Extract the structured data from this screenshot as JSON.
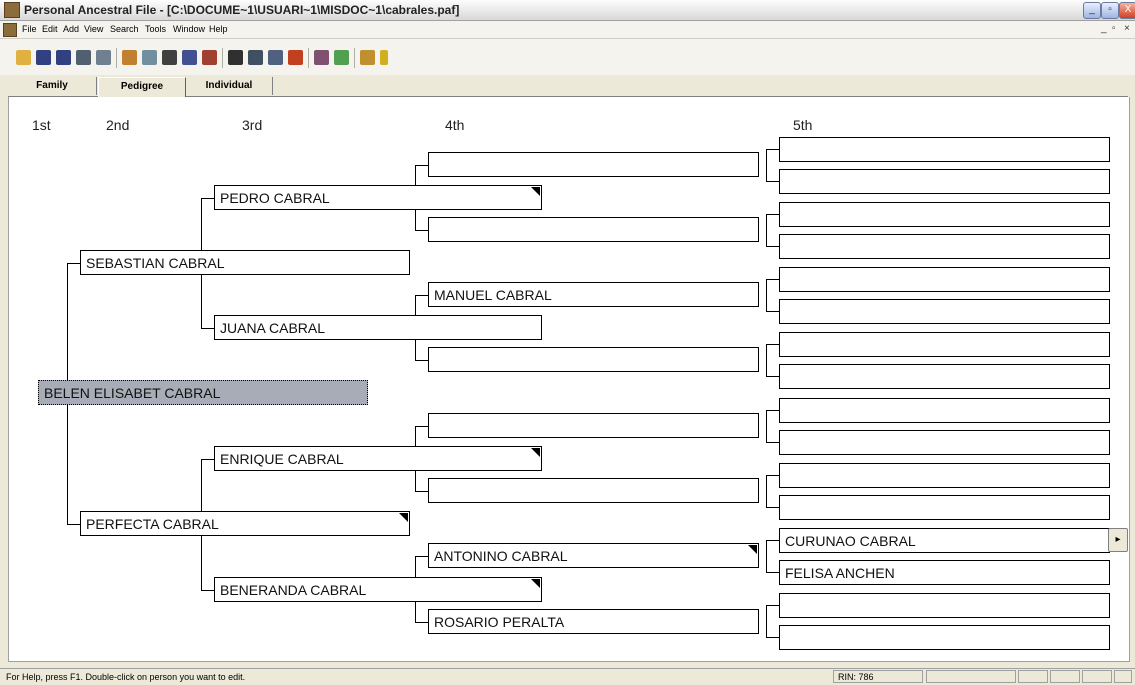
{
  "window": {
    "title": "Personal Ancestral File - [C:\\DOCUME~1\\USUARI~1\\MISDOC~1\\cabrales.paf]",
    "controls": [
      "_",
      "▫",
      "X"
    ]
  },
  "menu": {
    "items": [
      "File",
      "Edit",
      "Add",
      "View",
      "Search",
      "Tools",
      "Window",
      "Help"
    ],
    "mdi_controls": [
      "_",
      "▫",
      "×"
    ]
  },
  "toolbar": {
    "icons": [
      "open-folder-icon",
      "save-icon",
      "save-as-icon",
      "print-preview-icon",
      "print-icon",
      "spell-icon",
      "edit-icon",
      "camera-icon",
      "find-person-icon",
      "find-family-icon",
      "binoculars-icon",
      "search-icon",
      "relationship-icon",
      "tree-icon",
      "reports-icon",
      "photo-icon",
      "scale-icon",
      "help-icon"
    ]
  },
  "tabs": [
    "Family",
    "Pedigree",
    "Individual"
  ],
  "active_tab": "Pedigree",
  "generations": [
    "1st",
    "2nd",
    "3rd",
    "4th",
    "5th"
  ],
  "pedigree": {
    "gen1": "BELEN ELISABET CABRAL",
    "gen2": [
      "SEBASTIAN CABRAL",
      "PERFECTA CABRAL"
    ],
    "gen3": [
      "PEDRO CABRAL",
      "JUANA CABRAL",
      "ENRIQUE CABRAL",
      "BENERANDA CABRAL"
    ],
    "gen4": [
      "",
      "",
      "MANUEL CABRAL",
      "",
      "",
      "",
      "ANTONINO CABRAL",
      "ROSARIO PERALTA"
    ],
    "gen5": [
      "",
      "",
      "",
      "",
      "",
      "",
      "",
      "",
      "",
      "",
      "",
      "",
      "CURUNAO CABRAL",
      "FELISA ANCHEN",
      "",
      ""
    ]
  },
  "nav_arrow": "▸",
  "status": {
    "help": "For Help, press F1. Double-click on person you want to edit.",
    "rin": "RIN: 786"
  }
}
